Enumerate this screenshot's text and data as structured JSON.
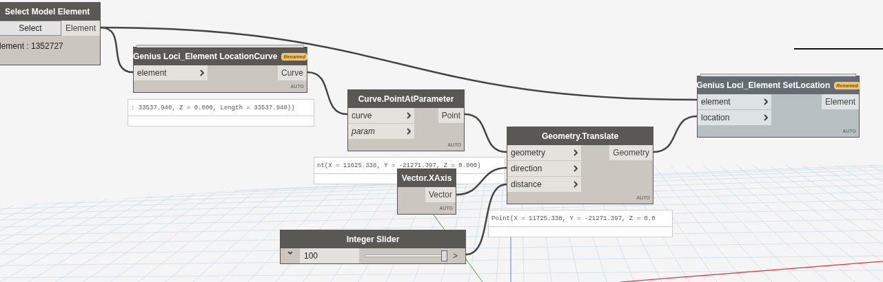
{
  "nodes": [
    {
      "kind": "select",
      "title": "Select Model Element",
      "button": "Select",
      "outputs": [
        "Element"
      ],
      "info": "lement : 1352727",
      "selected": false
    },
    {
      "kind": "function",
      "title": "Genius Loci_Element LocationCurve",
      "badge": "Renamed",
      "inputs": [
        {
          "name": "element",
          "has_default": false
        }
      ],
      "outputs": [
        "Curve"
      ],
      "lacing": "AUTO",
      "selected": false
    },
    {
      "kind": "function",
      "title": "Curve.PointAtParameter",
      "inputs": [
        {
          "name": "curve",
          "has_default": false
        },
        {
          "name": "param",
          "has_default": true
        }
      ],
      "outputs": [
        "Point"
      ],
      "lacing": "AUTO",
      "selected": false
    },
    {
      "kind": "function",
      "title": "Geometry.Translate",
      "inputs": [
        {
          "name": "geometry",
          "has_default": false
        },
        {
          "name": "direction",
          "has_default": false
        },
        {
          "name": "distance",
          "has_default": false
        }
      ],
      "outputs": [
        "Geometry"
      ],
      "lacing": "AUTO",
      "selected": false
    },
    {
      "kind": "function",
      "title": "Vector.XAxis",
      "outputs": [
        "Vector"
      ],
      "lacing": "AUTO",
      "selected": false
    },
    {
      "kind": "slider",
      "title": "Integer Slider",
      "value": "100",
      "level": 1,
      "output_symbol": ">",
      "selected": false
    },
    {
      "kind": "function",
      "title": "Genius Loci_Element SetLocation",
      "badge": "Renamed",
      "inputs": [
        {
          "name": "element",
          "has_default": false
        },
        {
          "name": "location",
          "has_default": false
        }
      ],
      "outputs": [
        "Element"
      ],
      "lacing": "AUTO",
      "selected": true
    }
  ],
  "previews": [
    {
      "text": ": 33537.940, Z = 0.000, Length = 33537.940))"
    },
    {
      "text": "nt(X = 11625.338, Y = -21271.397, Z = 0.000)"
    },
    {
      "text": "Point(X = 11725.338, Y = -21271.397, Z = 0.0"
    }
  ]
}
